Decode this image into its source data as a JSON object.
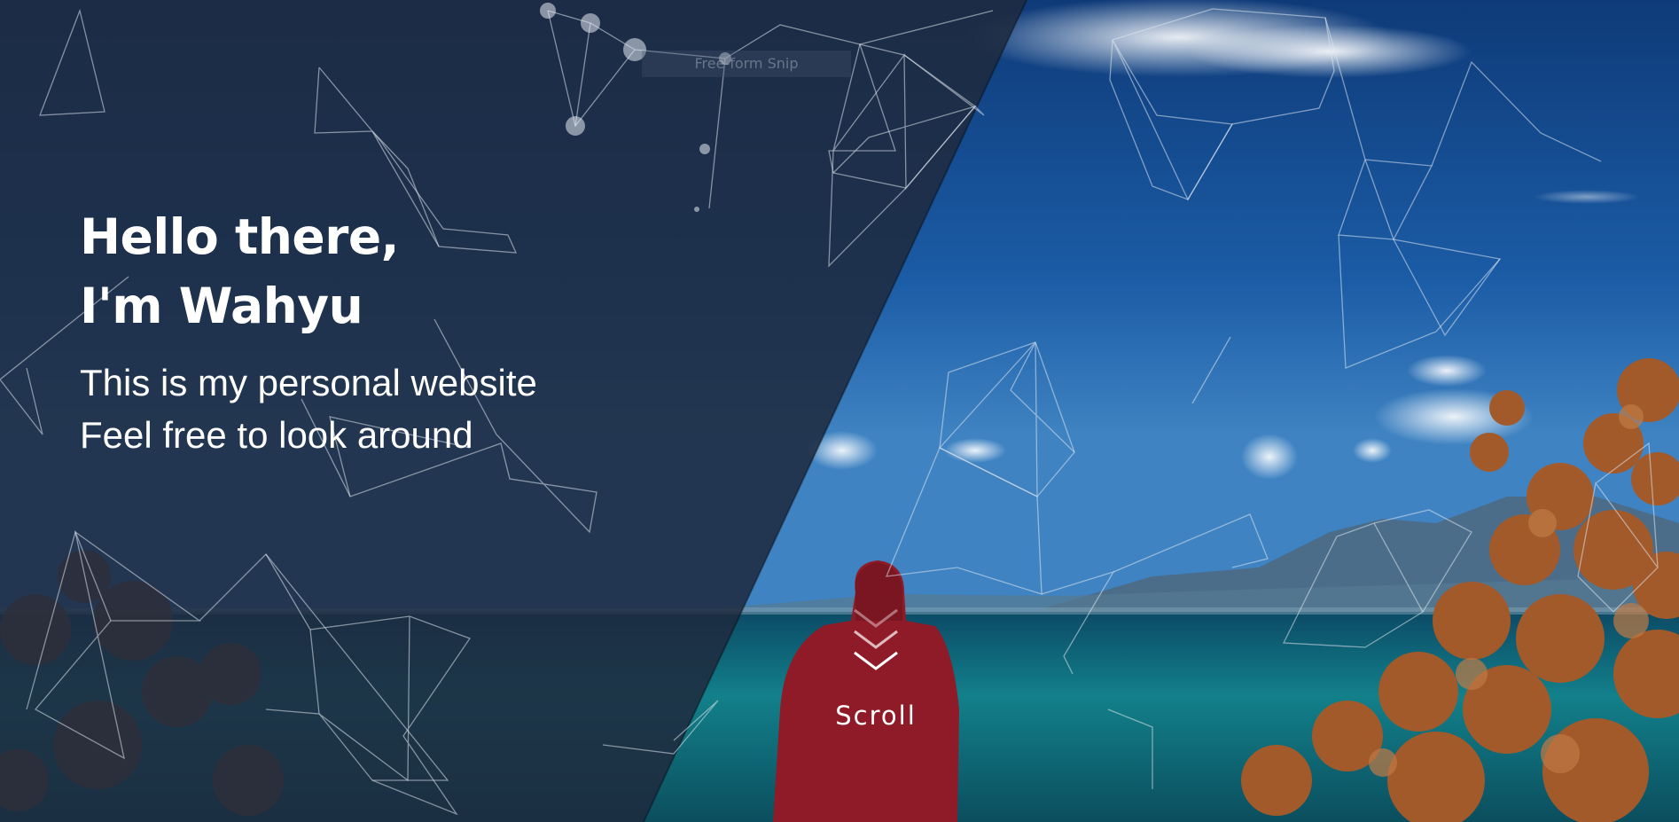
{
  "hero": {
    "greeting": "Hello there,",
    "name_line": "I'm Wahyu",
    "subtitle_1": "This is my personal website",
    "subtitle_2": "Feel free to look around"
  },
  "snip_overlay": {
    "label": "Free-form Snip"
  },
  "scroll": {
    "label": "Scroll",
    "icon": "chevron-down-icon"
  },
  "colors": {
    "overlay": "#1e2a3e",
    "text": "#ffffff",
    "sky": "#1a4f95",
    "sea": "#0e6d82",
    "hoodie": "#9b1d2a",
    "foliage": "#a0522d",
    "network_lines": "#dfe6ef"
  }
}
